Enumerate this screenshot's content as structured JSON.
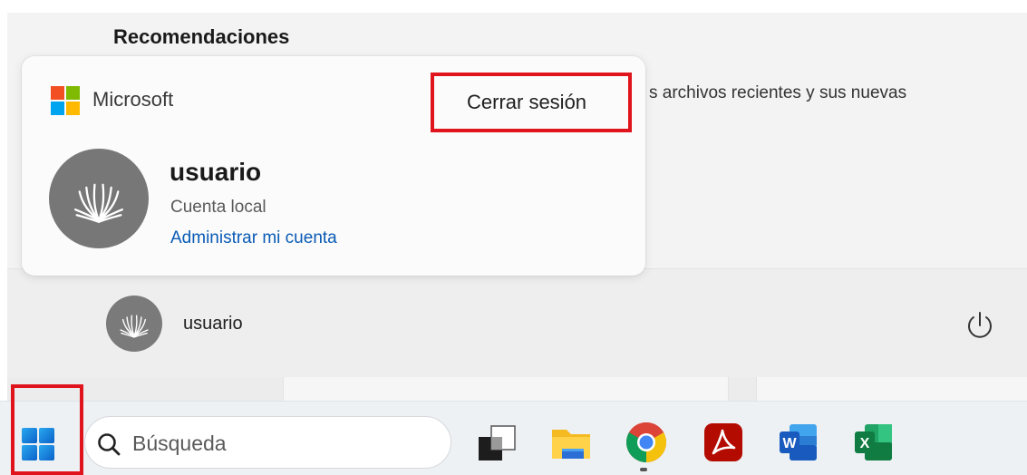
{
  "start_menu": {
    "section_title": "Recomendaciones",
    "recommendation_text": "s archivos recientes y sus nuevas"
  },
  "account_card": {
    "brand": "Microsoft",
    "sign_out_label": "Cerrar sesión",
    "user_name": "usuario",
    "account_type": "Cuenta local",
    "manage_link": "Administrar mi cuenta"
  },
  "footer": {
    "user_name": "usuario",
    "power_icon": "power-icon"
  },
  "taskbar": {
    "search_placeholder": "Búsqueda",
    "apps": [
      "task-view-icon",
      "file-explorer-icon",
      "chrome-icon",
      "acrobat-icon",
      "word-icon",
      "excel-icon"
    ]
  },
  "colors": {
    "highlight_red": "#e0141c",
    "link_blue": "#0a5bb5",
    "avatar_gray": "#777777"
  }
}
